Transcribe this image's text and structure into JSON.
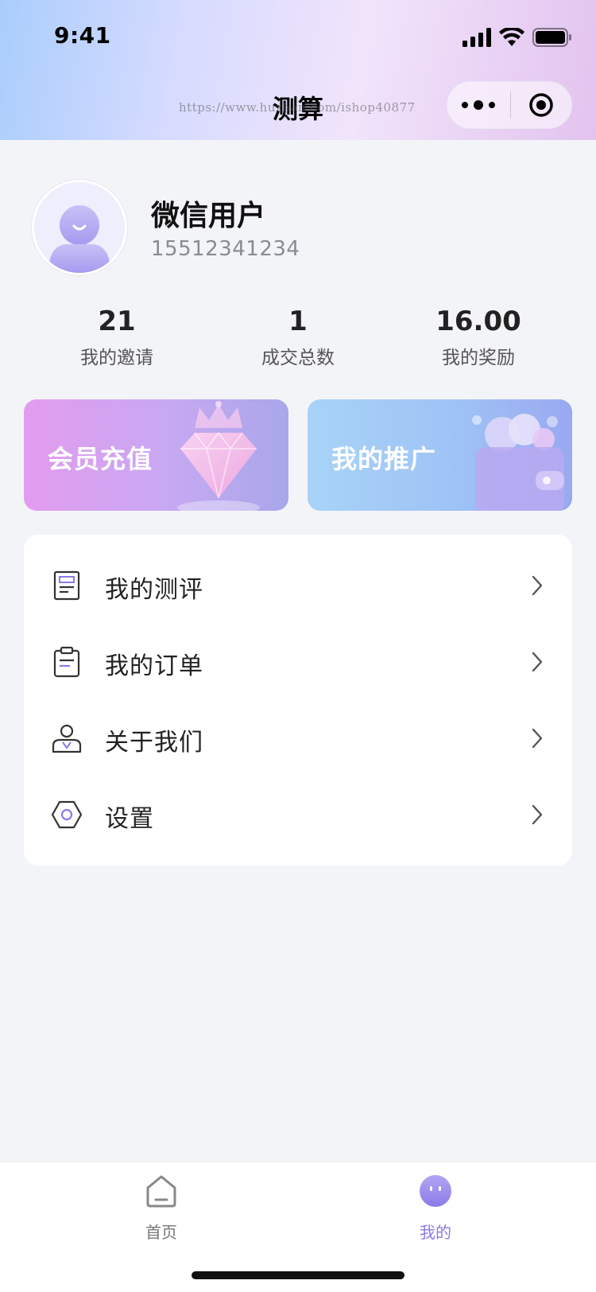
{
  "status_bar": {
    "time": "9:41"
  },
  "nav": {
    "title": "测算",
    "watermark": "https://www.huzhan.com/ishop40877",
    "more_icon": "more-dots-icon",
    "close_icon": "target-circle-icon"
  },
  "profile": {
    "name": "微信用户",
    "phone": "15512341234",
    "avatar_icon": "user-avatar-icon"
  },
  "stats": [
    {
      "value": "21",
      "label": "我的邀请"
    },
    {
      "value": "1",
      "label": "成交总数"
    },
    {
      "value": "16.00",
      "label": "我的奖励"
    }
  ],
  "promos": {
    "vip": {
      "label": "会员充值",
      "icon": "diamond-crown-icon"
    },
    "share": {
      "label": "我的推广",
      "icon": "wallet-coins-icon"
    }
  },
  "menu": [
    {
      "label": "我的测评",
      "icon": "report-icon"
    },
    {
      "label": "我的订单",
      "icon": "clipboard-icon"
    },
    {
      "label": "关于我们",
      "icon": "person-icon"
    },
    {
      "label": "设置",
      "icon": "hexagon-settings-icon"
    }
  ],
  "tabbar": {
    "home": {
      "label": "首页",
      "icon": "home-icon"
    },
    "mine": {
      "label": "我的",
      "icon": "mine-face-icon"
    }
  },
  "colors": {
    "accent": "#8a7be6",
    "tab_inactive": "#777777",
    "tab_active": "#8a7be6",
    "page_bg": "#f3f4f8"
  }
}
